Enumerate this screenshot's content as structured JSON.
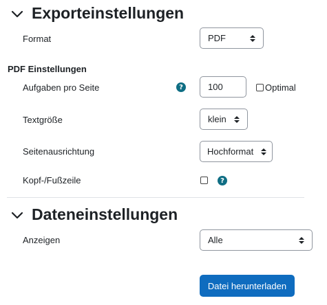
{
  "export_section": {
    "title": "Exporteinstellungen",
    "format_label": "Format",
    "format_value": "PDF",
    "pdf_subheading": "PDF Einstellungen",
    "tasks_per_page_label": "Aufgaben pro Seite",
    "tasks_per_page_value": "100",
    "optimal_label": "Optimal",
    "text_size_label": "Textgröße",
    "text_size_value": "klein",
    "orientation_label": "Seitenausrichtung",
    "orientation_value": "Hochformat",
    "header_footer_label": "Kopf-/Fußzeile"
  },
  "data_section": {
    "title": "Dateneinstellungen",
    "show_label": "Anzeigen",
    "show_value": "Alle"
  },
  "download_button": "Datei herunterladen",
  "icons": {
    "help": "?",
    "collapse": "chevron-down-icon",
    "select": "up-down-caret-icon"
  },
  "colors": {
    "primary_button": "#0f6cbf",
    "help_icon": "#0f6e84",
    "text": "#1d2125",
    "border": "#8f959e"
  }
}
